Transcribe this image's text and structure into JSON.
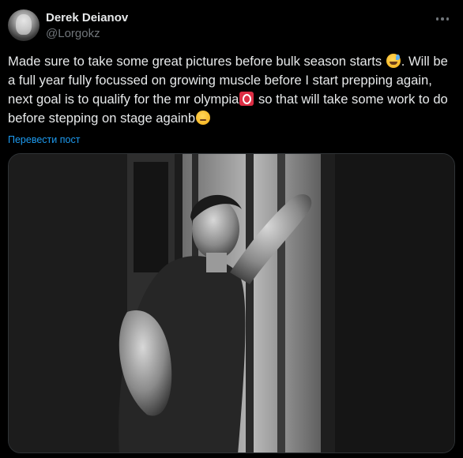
{
  "user": {
    "display_name": "Derek Deianov",
    "handle": "@Lorgokz"
  },
  "tweet": {
    "segment_1": "Made sure to take some great pictures before bulk season starts ",
    "emoji_1": "sweat-smile-emoji",
    "segment_2": ". Will be a full year fully focussed on growing muscle before I start prepping again, next goal is to qualify for the mr olympia",
    "emoji_2": "red-o-emoji",
    "segment_3": " so that will take some work to do before stepping on stage againb",
    "emoji_3": "face-emoji"
  },
  "translate_label": "Перевести пост",
  "colors": {
    "background": "#000000",
    "text": "#e7e9ea",
    "muted": "#71767b",
    "link": "#1d9bf0"
  }
}
